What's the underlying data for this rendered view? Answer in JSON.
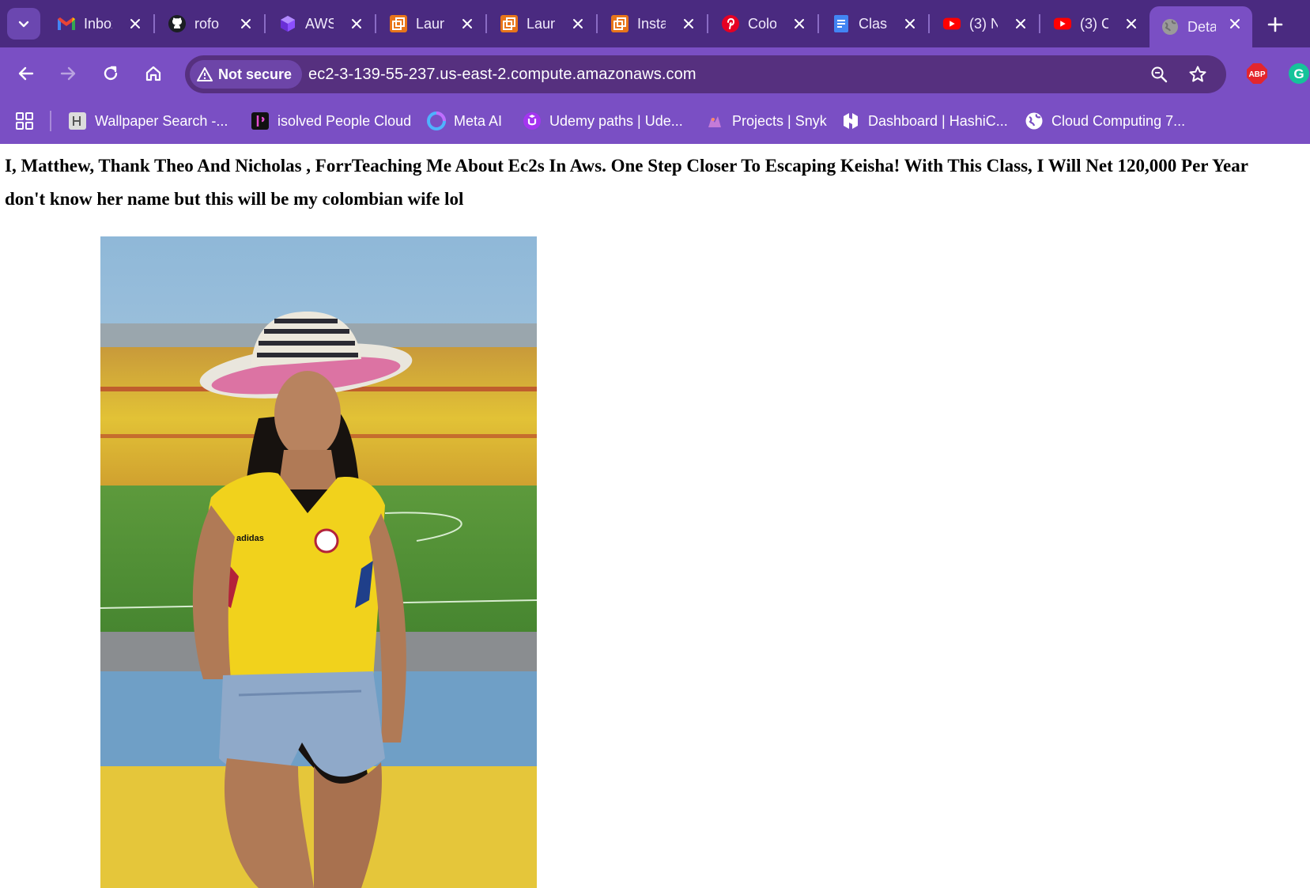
{
  "browser": {
    "tabs": [
      {
        "title": "Inbox",
        "icon": "gmail-icon",
        "active": false
      },
      {
        "title": "rofo",
        "icon": "github-icon",
        "active": false
      },
      {
        "title": "AWS",
        "icon": "aws-cube-icon",
        "active": false
      },
      {
        "title": "Laun",
        "icon": "launch-icon",
        "active": false
      },
      {
        "title": "Laun",
        "icon": "launch-icon",
        "active": false
      },
      {
        "title": "Insta",
        "icon": "launch-icon",
        "active": false
      },
      {
        "title": "Colo",
        "icon": "pinterest-icon",
        "active": false
      },
      {
        "title": "Clas",
        "icon": "docs-icon",
        "active": false
      },
      {
        "title": "(3) N",
        "icon": "youtube-icon",
        "active": false
      },
      {
        "title": "(3) C",
        "icon": "youtube-icon",
        "active": false
      },
      {
        "title": "Deta",
        "icon": "globe-icon",
        "active": true
      }
    ],
    "security_label": "Not secure",
    "url": "ec2-3-139-55-237.us-east-2.compute.amazonaws.com",
    "extensions": {
      "abp_label": "ABP",
      "grammarly_label": "G"
    },
    "bookmarks": [
      {
        "label": "Wallpaper Search -...",
        "icon": "wallpaper-icon"
      },
      {
        "label": "isolved People Cloud",
        "icon": "isolved-icon"
      },
      {
        "label": "Meta AI",
        "icon": "meta-ai-icon"
      },
      {
        "label": "Udemy paths | Ude...",
        "icon": "udemy-icon"
      },
      {
        "label": "Projects | Snyk",
        "icon": "snyk-icon"
      },
      {
        "label": "Dashboard | HashiC...",
        "icon": "hashicorp-icon"
      },
      {
        "label": "Cloud Computing 7...",
        "icon": "globe-icon"
      }
    ],
    "colors": {
      "tabstrip": "#4a2a80",
      "toolbar": "#7a4fc4",
      "omnibox": "#56307f"
    }
  },
  "page": {
    "heading_line1": "I, Matthew, Thank Theo And Nicholas , ForrTeaching Me About Ec2s In Aws. One Step Closer To Escaping Keisha! With This Class, I Will Net 120,000 Per Year",
    "heading_line2": "don't know her name but this will be my colombian wife lol",
    "photo_logo_text": "adidas"
  }
}
